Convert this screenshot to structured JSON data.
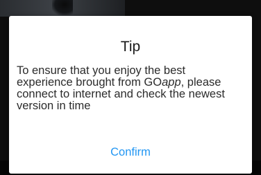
{
  "dialog": {
    "title": "Tip",
    "message_part1": "To ensure that you enjoy the best experience brought from GO",
    "app_name_emphasis": "app",
    "message_part2": ", please connect to internet and check the newest version in time",
    "confirm_label": "Confirm"
  },
  "colors": {
    "accent": "#2196f3",
    "dialog_background": "#ffffff",
    "overlay_background": "#0e0e0e"
  }
}
